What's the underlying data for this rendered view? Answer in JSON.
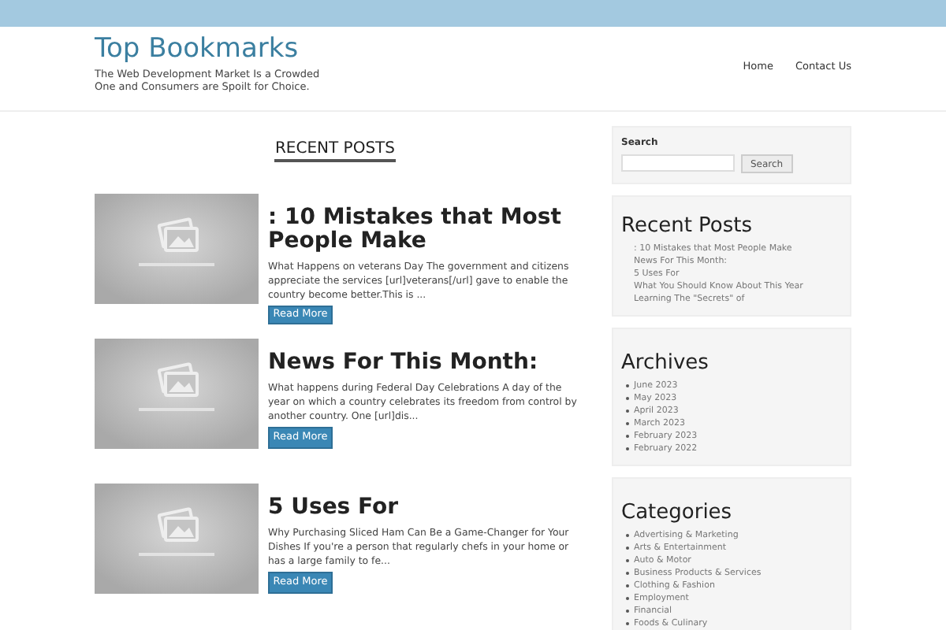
{
  "site": {
    "title": "Top Bookmarks",
    "tagline": "The Web Development Market Is a Crowded One and Consumers are Spoilt for Choice."
  },
  "nav": [
    {
      "label": "Home"
    },
    {
      "label": "Contact Us"
    }
  ],
  "section_heading": "RECENT POSTS",
  "posts": [
    {
      "title": ": 10 Mistakes that Most People Make",
      "excerpt": "What Happens on veterans Day The government and citizens appreciate the services [url]veterans[/url] gave to enable the country become better.This is ...",
      "button": "Read More"
    },
    {
      "title": "News For This Month:",
      "excerpt": "What happens during Federal Day Celebrations A day of the year on which a country celebrates its freedom from control by another country. One [url]dis...",
      "button": "Read More"
    },
    {
      "title": "5 Uses For",
      "excerpt": "Why Purchasing Sliced Ham Can Be a Game-Changer for Your Dishes If you're a person that regularly chefs in your home or has a large family to fe...",
      "button": "Read More"
    }
  ],
  "sidebar": {
    "search": {
      "label": "Search",
      "button": "Search"
    },
    "recent_posts": {
      "title": "Recent Posts",
      "items": [
        ": 10 Mistakes that Most People Make",
        "News For This Month:",
        "5 Uses For",
        "What You Should Know About This Year",
        "Learning The \"Secrets\" of"
      ]
    },
    "archives": {
      "title": "Archives",
      "items": [
        "June 2023",
        "May 2023",
        "April 2023",
        "March 2023",
        "February 2023",
        "February 2022"
      ]
    },
    "categories": {
      "title": "Categories",
      "items": [
        "Advertising & Marketing",
        "Arts & Entertainment",
        "Auto & Motor",
        "Business Products & Services",
        "Clothing & Fashion",
        "Employment",
        "Financial",
        "Foods & Culinary"
      ]
    }
  }
}
